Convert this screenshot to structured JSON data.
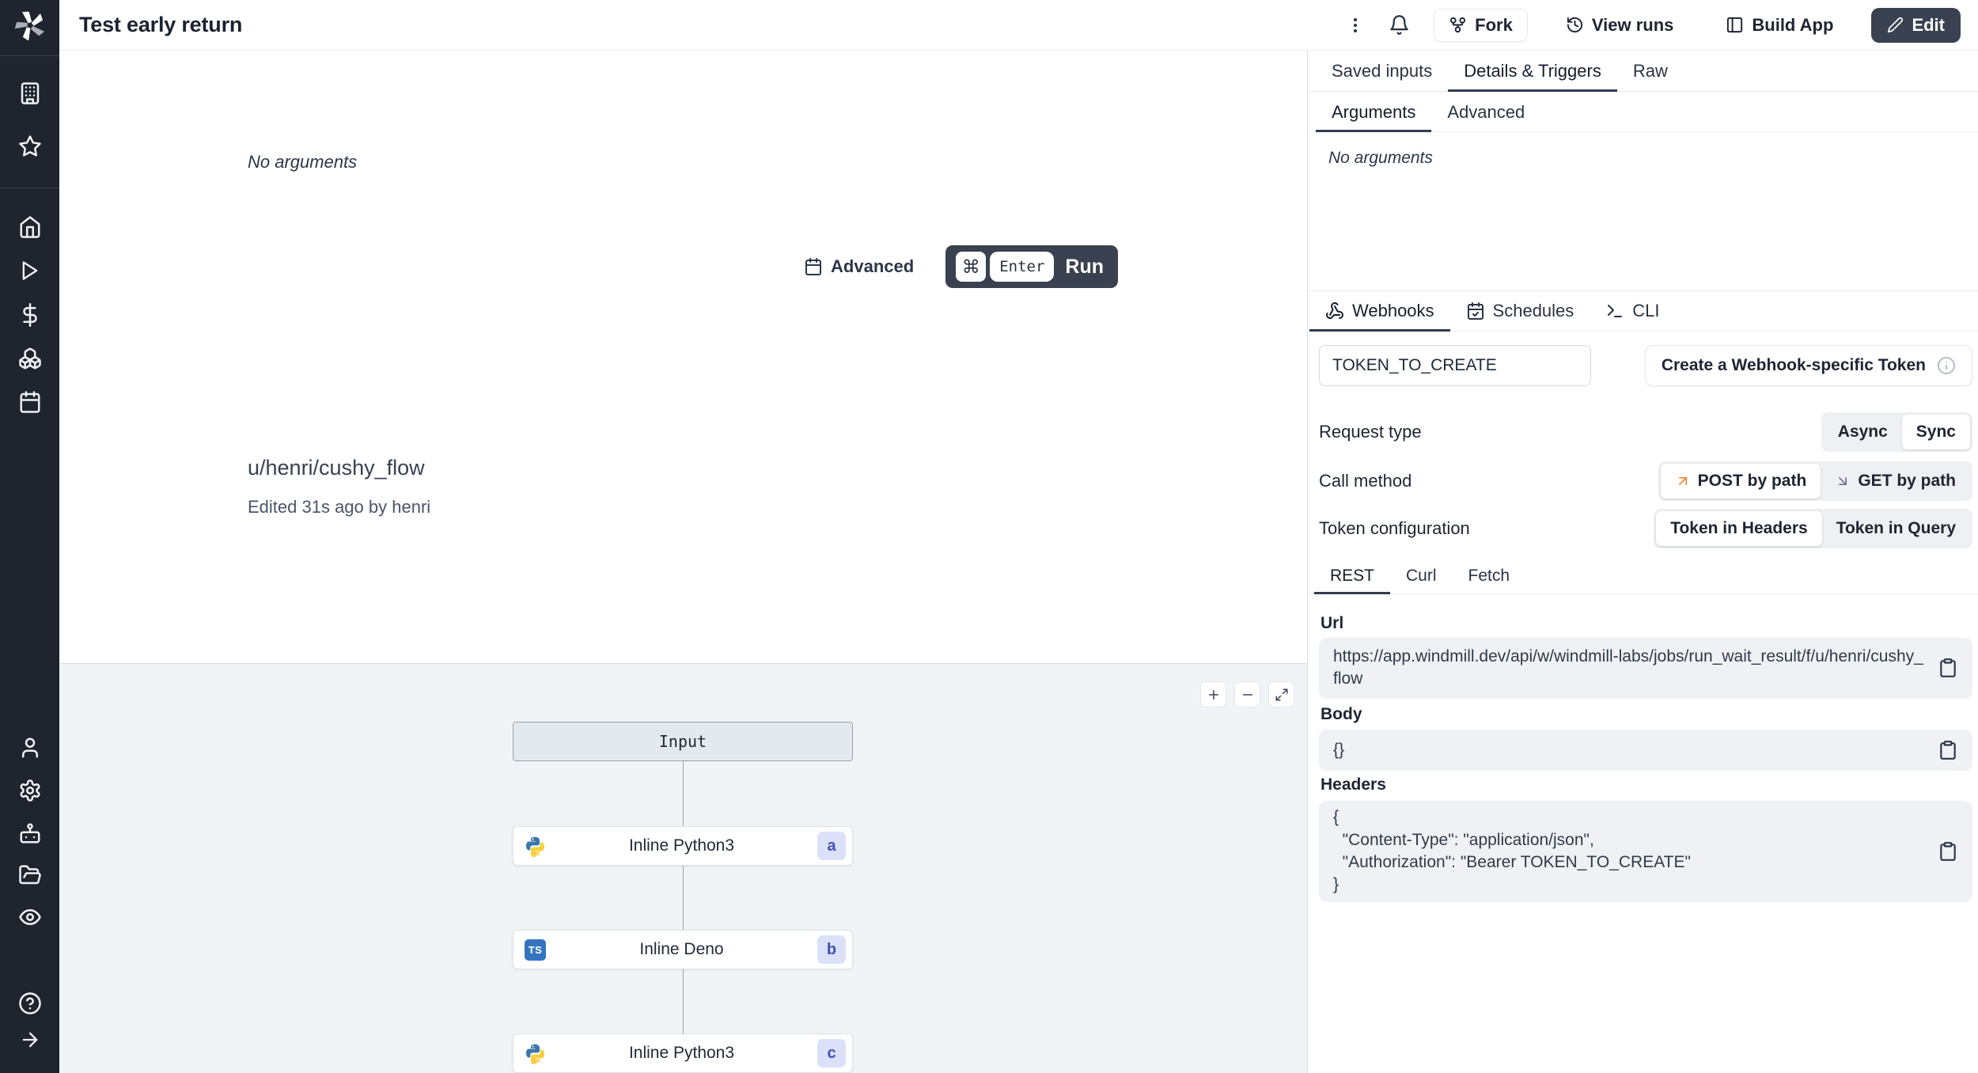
{
  "app": {
    "title": "Test early return"
  },
  "topbar": {
    "fork": "Fork",
    "view_runs": "View runs",
    "build_app": "Build App",
    "edit": "Edit"
  },
  "main": {
    "no_arguments": "No arguments",
    "advanced": "Advanced",
    "run": {
      "cmd": "⌘",
      "enter": "Enter",
      "label": "Run"
    },
    "flow_path": "u/henri/cushy_flow",
    "edited_info": "Edited 31s ago by henri"
  },
  "graph": {
    "input": "Input",
    "ts_label": "TS",
    "nodes": [
      {
        "label": "Inline Python3",
        "badge": "a"
      },
      {
        "label": "Inline Deno",
        "badge": "b"
      },
      {
        "label": "Inline Python3",
        "badge": "c"
      }
    ]
  },
  "panel": {
    "tabs": {
      "saved_inputs": "Saved inputs",
      "details_triggers": "Details & Triggers",
      "raw": "Raw"
    },
    "subtabs": {
      "arguments": "Arguments",
      "advanced": "Advanced"
    },
    "no_arguments": "No arguments",
    "triggers": {
      "webhooks": "Webhooks",
      "schedules": "Schedules",
      "cli": "CLI"
    },
    "token_value": "TOKEN_TO_CREATE",
    "create_token": "Create a Webhook-specific Token",
    "request_type": {
      "label": "Request type",
      "async": "Async",
      "sync": "Sync"
    },
    "call_method": {
      "label": "Call method",
      "post": "POST by path",
      "get": "GET by path"
    },
    "token_config": {
      "label": "Token configuration",
      "headers": "Token in Headers",
      "query": "Token in Query"
    },
    "code_tabs": {
      "rest": "REST",
      "curl": "Curl",
      "fetch": "Fetch"
    },
    "url_label": "Url",
    "url_value": "https://app.windmill.dev/api/w/windmill-labs/jobs/run_wait_result/f/u/henri/cushy_flow",
    "body_label": "Body",
    "body_value": "{}",
    "headers_label": "Headers",
    "headers_value": "{\n  \"Content-Type\": \"application/json\",\n  \"Authorization\": \"Bearer TOKEN_TO_CREATE\"\n}"
  },
  "colors": {
    "sidebar_bg": "#1f242e",
    "dark_button": "#3a4150",
    "accent_orange": "#ee8634",
    "badge_bg": "#dbe1f9",
    "badge_text": "#4150b5",
    "graph_bg": "#f1f4f7"
  }
}
